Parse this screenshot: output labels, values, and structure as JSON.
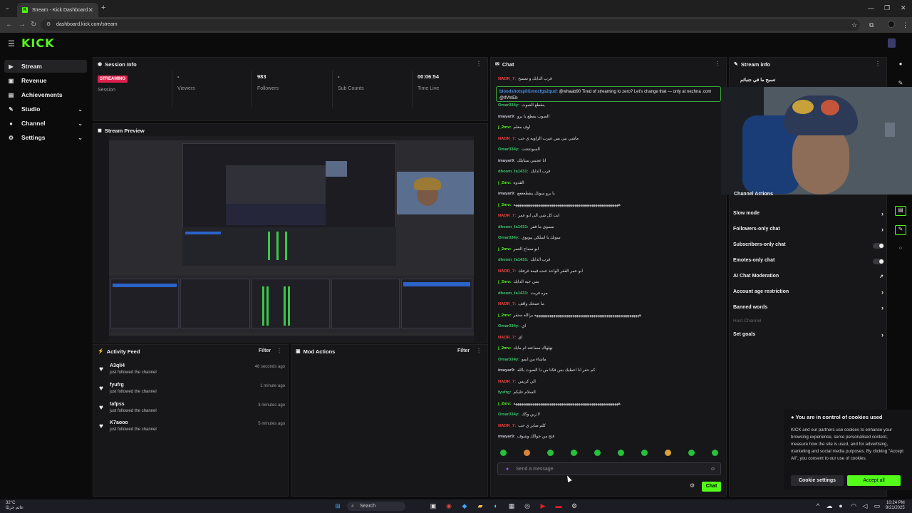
{
  "browser": {
    "tab_title": "Stream - Kick Dashboard",
    "url": "dashboard.kick.com/stream"
  },
  "brand": {
    "logo": "KICK",
    "accent_color": "#53fc18"
  },
  "sidebar": {
    "items": [
      {
        "label": "Stream",
        "icon": "video-icon"
      },
      {
        "label": "Revenue",
        "icon": "money-icon"
      },
      {
        "label": "Achievements",
        "icon": "trophy-icon"
      },
      {
        "label": "Studio",
        "icon": "studio-icon"
      },
      {
        "label": "Channel",
        "icon": "user-icon"
      },
      {
        "label": "Settings",
        "icon": "gear-icon"
      }
    ]
  },
  "session_info": {
    "title": "Session Info",
    "stats": [
      {
        "value": "STREAMING",
        "label": "Session"
      },
      {
        "value": "-",
        "label": "Viewers"
      },
      {
        "value": "983",
        "label": "Followers"
      },
      {
        "value": "-",
        "label": "Sub Counts"
      },
      {
        "value": "00:06:54",
        "label": "Time Live"
      }
    ]
  },
  "stream_preview": {
    "title": "Stream Preview"
  },
  "activity_feed": {
    "title": "Activity Feed",
    "filter_label": "Filter",
    "items": [
      {
        "name": "A3qli4",
        "action": "just followed the channel",
        "time": "46 seconds ago"
      },
      {
        "name": "fyufrg",
        "action": "just followed the channel",
        "time": "1 minute ago"
      },
      {
        "name": "tafpss",
        "action": "just followed the channel",
        "time": "3 minutes ago"
      },
      {
        "name": "K7aooo",
        "action": "just followed the channel",
        "time": "5 minutes ago"
      }
    ]
  },
  "mod_actions": {
    "title": "Mod Actions",
    "filter_label": "Filter"
  },
  "chat": {
    "title": "Chat",
    "pinned": {
      "user": "bloodshotspill1mocfgs2qud:",
      "text": "@whaab90 Tired of streaming to zero? Let's change that — only at nezhna .com @lfVhtEb"
    },
    "messages": [
      {
        "user": "NADR_7:",
        "color": "#e8433a",
        "text": "قرب الدايك و تمسح"
      },
      {
        "user": "Omar334y:",
        "color": "#3ac46a",
        "text": "ينقطع الصوت"
      },
      {
        "user": "imayar9:",
        "color": "#c9c9d6",
        "text": "الصوت يقطع يا برو"
      },
      {
        "user": "j_2mv:",
        "color": "#53fc18",
        "text": "اوف معلم"
      },
      {
        "user": "NADR_7:",
        "color": "#e8433a",
        "text": "ماشي نبي بس عيرت الزاويه ي حب"
      },
      {
        "user": "Omar334y:",
        "color": "#3ac46a",
        "text": "السوتتتتتت"
      },
      {
        "user": "imayar9:",
        "color": "#c9c9d6",
        "text": "انا عجبني ستايلك"
      },
      {
        "user": "dhoom_fa1431:",
        "color": "#3ac46a",
        "text": "قرب الدايك"
      },
      {
        "user": "j_2mv:",
        "color": "#53fc18",
        "text": "القدوه"
      },
      {
        "user": "imayar9:",
        "color": "#c9c9d6",
        "text": "يا برو سوتك ينقطعععع"
      },
      {
        "user": "j_2mv:",
        "color": "#53fc18",
        "text": "هههههههههههههههههههههههههههههههههههههههههههههههههههههههه"
      },
      {
        "user": "NADR_7:",
        "color": "#e8433a",
        "text": "انت كل شي الى ابو عمر"
      },
      {
        "user": "dhoom_fa1431:",
        "color": "#3ac46a",
        "text": "مسوي ما قفر"
      },
      {
        "user": "Omar334y:",
        "color": "#3ac46a",
        "text": "سوتك يا اسلكي يبوبوي"
      },
      {
        "user": "j_2mv:",
        "color": "#53fc18",
        "text": "ابو سماح العمر"
      },
      {
        "user": "dhoom_fa1431:",
        "color": "#3ac46a",
        "text": "قرب الدايك"
      },
      {
        "user": "NADR_7:",
        "color": "#e8433a",
        "text": "ابو عمر القفر الواحد عنده قيمة غرفتك"
      },
      {
        "user": "j_2mv:",
        "color": "#53fc18",
        "text": "بتني جيه الدايك"
      },
      {
        "user": "dhoom_fa1431:",
        "color": "#3ac46a",
        "text": "مره قربت"
      },
      {
        "user": "NADR_7:",
        "color": "#e8433a",
        "text": "ما عمحك واقف"
      },
      {
        "user": "j_2mv:",
        "color": "#53fc18",
        "text": "هههههههههههههههههههههههههههههههههههههههههههههههههههههههه يرالله ستقر"
      },
      {
        "user": "Omar334y:",
        "color": "#3ac46a",
        "text": "اي"
      },
      {
        "user": "NADR_7:",
        "color": "#e8433a",
        "text": "اي"
      },
      {
        "user": "j_2mv:",
        "color": "#53fc18",
        "text": "تهلهاك سماعته ام مايك"
      },
      {
        "user": "Omar334y:",
        "color": "#3ac46a",
        "text": "ماشاء من ايمو"
      },
      {
        "user": "imayar9:",
        "color": "#c9c9d6",
        "text": "كم حفر انا اعطيك بس فكنا من ذا الصوت بالله"
      },
      {
        "user": "NADR_7:",
        "color": "#e8433a",
        "text": "الي كريس"
      },
      {
        "user": "fyufrg:",
        "color": "#3ac46a",
        "text": "السلام عليكم"
      },
      {
        "user": "j_2mv:",
        "color": "#53fc18",
        "text": "هههههههههههههههههههههههههههههههههههههههههههههههههههههههه"
      },
      {
        "user": "Omar334y:",
        "color": "#3ac46a",
        "text": "لا زين وكك"
      },
      {
        "user": "NADR_7:",
        "color": "#e8433a",
        "text": "كلم صابر ي حب"
      },
      {
        "user": "imayar9:",
        "color": "#c9c9d6",
        "text": "فتح من جوالك وشوف"
      }
    ],
    "input_placeholder": "Send a message",
    "send_label": "Chat"
  },
  "stream_info": {
    "title": "Stream info",
    "stream_title": "تسبح ما في جنبائم"
  },
  "channel_actions": {
    "title": "Channel Actions",
    "items": [
      {
        "label": "Slow mode",
        "kind": "arrow"
      },
      {
        "label": "Followers-only chat",
        "kind": "arrow"
      },
      {
        "label": "Subscribers-only chat",
        "kind": "toggle"
      },
      {
        "label": "Emotes-only chat",
        "kind": "toggle"
      },
      {
        "label": "AI Chat Moderation",
        "kind": "external"
      },
      {
        "label": "Account age restriction",
        "kind": "arrow"
      },
      {
        "label": "Banned words",
        "kind": "arrow"
      },
      {
        "label": "Host Channel",
        "kind": "disabled"
      },
      {
        "label": "Set goals",
        "kind": "arrow"
      }
    ]
  },
  "cookie_banner": {
    "title": "You are in control of cookies used",
    "body": "KICK and our partners use cookies to enhance your browsing experience, serve personalised content, measure how the site is used, and for advertising, marketing and social media purposes. By clicking \"Accept All\", you consent to our use of cookies.",
    "settings_label": "Cookie settings",
    "accept_label": "Accept all"
  },
  "taskbar": {
    "weather_temp": "32°C",
    "weather_text": "غائم جزئيًا",
    "search_label": "Search",
    "time": "10:24 PM",
    "date": "9/21/2025"
  }
}
